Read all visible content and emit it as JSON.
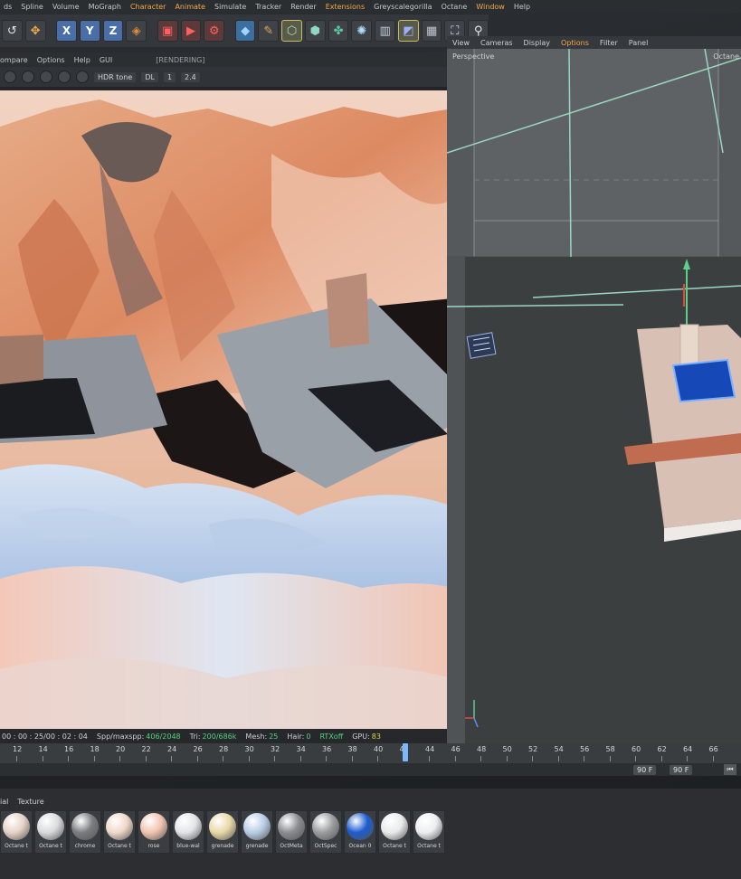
{
  "menu": {
    "items": [
      "ds",
      "Spline",
      "Volume",
      "MoGraph",
      "Character",
      "Animate",
      "Simulate",
      "Tracker",
      "Render",
      "Extensions",
      "Greyscalegorilla",
      "Octane",
      "Window",
      "Help"
    ],
    "active_index": 4
  },
  "toolbar": {
    "axes": [
      "X",
      "Y",
      "Z"
    ]
  },
  "render": {
    "menu": [
      "ompare",
      "Options",
      "Help",
      "GUI"
    ],
    "status_label": "[RENDERING]",
    "tonemap": "HDR tone",
    "kernel": "DL",
    "value1": "1",
    "value2": "2.4",
    "status_bar": {
      "time": "00 : 00 : 25/00 : 02 : 04",
      "spp_label": "Spp/maxspp:",
      "spp": "406/2048",
      "tri_label": "Tri:",
      "tri": "200/686k",
      "mesh_label": "Mesh:",
      "mesh": "25",
      "hair_label": "Hair:",
      "hair": "0",
      "rtx": "RTXoff",
      "gpu_label": "GPU:",
      "gpu": "83"
    }
  },
  "viewport": {
    "menu": [
      "View",
      "Cameras",
      "Display",
      "Options",
      "Filter",
      "Panel"
    ],
    "active_index": 3,
    "camera_label": "Perspective",
    "corner_label": "Octane"
  },
  "timeline": {
    "ticks": [
      "12",
      "14",
      "16",
      "18",
      "20",
      "22",
      "24",
      "26",
      "28",
      "30",
      "32",
      "34",
      "36",
      "38",
      "40",
      "42",
      "44",
      "46",
      "48",
      "50",
      "52",
      "54",
      "56",
      "58",
      "60",
      "62",
      "64",
      "66"
    ],
    "current_frame": "42",
    "end_frame_a": "90 F",
    "end_frame_b": "90 F"
  },
  "materials": {
    "tabs": [
      "ial",
      "Texture"
    ],
    "items": [
      {
        "label": "Octane t",
        "color": "#e6d2c6"
      },
      {
        "label": "Octane t",
        "color": "#d8dadc"
      },
      {
        "label": "chrome",
        "color": "#7a7c80"
      },
      {
        "label": "Octane t",
        "color": "#efd8c8"
      },
      {
        "label": "rose",
        "color": "#f0c4b0"
      },
      {
        "label": "blue-wal",
        "color": "#e2e4e6"
      },
      {
        "label": "grenade",
        "color": "#e8d8a6"
      },
      {
        "label": "grenade",
        "color": "#b8cde6"
      },
      {
        "label": "OctMeta",
        "color": "#8a8c90"
      },
      {
        "label": "OctSpec",
        "color": "#9a9c9e"
      },
      {
        "label": "Ocean 0",
        "color": "#1c5cd0"
      },
      {
        "label": "Octane t",
        "color": "#e8eaec"
      },
      {
        "label": "Octane t",
        "color": "#eceef0"
      }
    ]
  }
}
